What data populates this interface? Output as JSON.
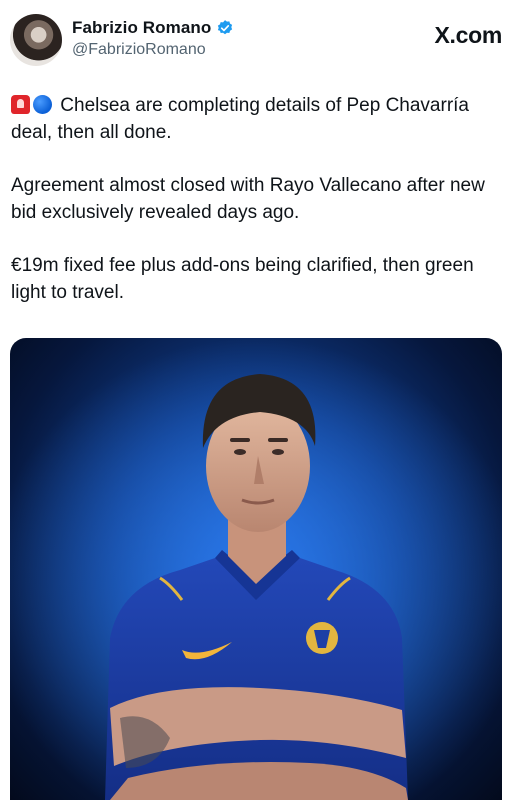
{
  "tweet": {
    "author_name": "Fabrizio Romano",
    "author_handle": "@FabrizioRomano",
    "brand": "X.com",
    "paragraphs": [
      "Chelsea are completing details of Pep Chavarría deal, then all done.",
      "Agreement almost closed with Rayo Vallecano after new bid exclusively revealed days ago.",
      "€19m fixed fee plus add-ons being clarified, then green light to travel."
    ],
    "lead_emojis": [
      "siren-emoji",
      "blue-circle-emoji"
    ]
  },
  "colors": {
    "verified": "#1d9bf0",
    "handle": "#536471",
    "text": "#0f1419",
    "photo_background": "#0f3a86",
    "shirt": "#1d3fa6"
  }
}
